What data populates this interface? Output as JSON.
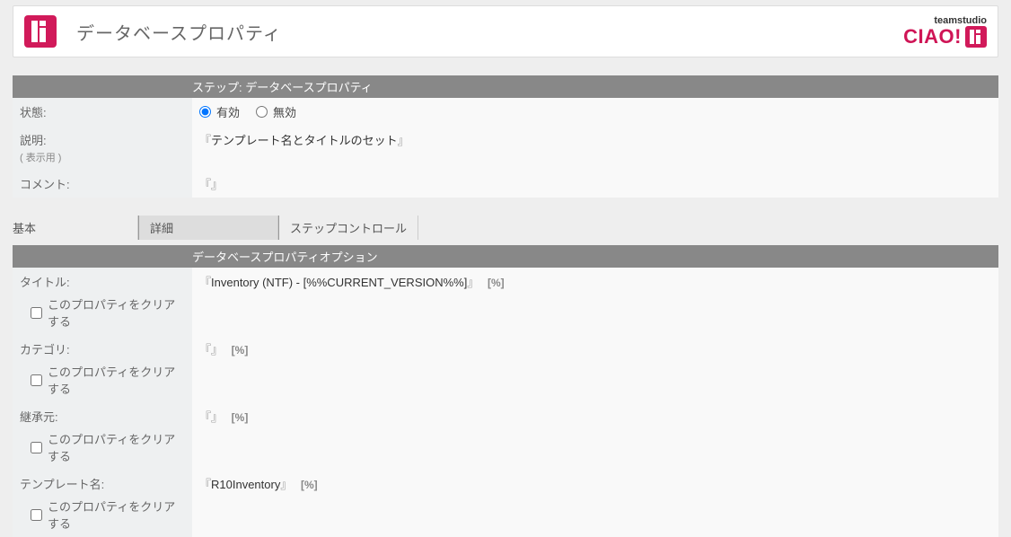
{
  "header": {
    "title": "データベースプロパティ",
    "brand_top": "teamstudio",
    "brand_ciao": "CIAO!"
  },
  "step_section": {
    "header": "ステップ: データベースプロパティ",
    "state_label": "状態:",
    "radio_enabled": "有効",
    "radio_disabled": "無効",
    "desc_label": "説明:",
    "desc_sub": "( 表示用 )",
    "desc_value": "テンプレート名とタイトルのセット",
    "comment_label": "コメント:",
    "comment_value": ""
  },
  "tabs": {
    "basic": "基本",
    "detail": "詳細",
    "step_control": "ステップコントロール"
  },
  "options_section": {
    "header": "データベースプロパティオプション",
    "clear_property_label": "このプロパティをクリアする",
    "rows": {
      "title_label": "タイトル:",
      "title_value": "Inventory (NTF) - [%%CURRENT_VERSION%%]",
      "category_label": "カテゴリ:",
      "category_value": "",
      "inherit_label": "継承元:",
      "inherit_value": "",
      "template_label": "テンプレート名:",
      "template_value": "R10Inventory"
    }
  },
  "glyphs": {
    "open_bracket": "『",
    "close_bracket": "』",
    "percent": "[%]"
  }
}
